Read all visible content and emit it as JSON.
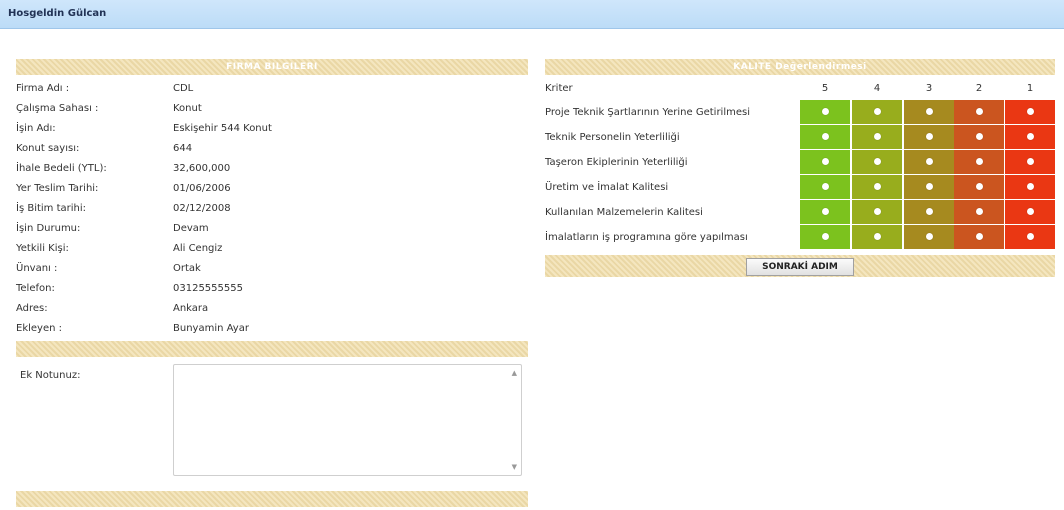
{
  "header": {
    "welcome": "Hosgeldin Gülcan"
  },
  "left_panel": {
    "title": "FIRMA BILGILERI",
    "rows": [
      {
        "label": "Firma Adı :",
        "value": "CDL"
      },
      {
        "label": "Çalışma Sahası :",
        "value": "Konut"
      },
      {
        "label": "İşin Adı:",
        "value": "Eskişehir 544 Konut"
      },
      {
        "label": "Konut sayısı:",
        "value": "644"
      },
      {
        "label": "İhale Bedeli (YTL):",
        "value": "32,600,000"
      },
      {
        "label": "Yer Teslim Tarihi:",
        "value": "01/06/2006"
      },
      {
        "label": "İş Bitim tarihi:",
        "value": "02/12/2008"
      },
      {
        "label": "İşin Durumu:",
        "value": "Devam"
      },
      {
        "label": "Yetkili Kişi:",
        "value": "Ali Cengiz"
      },
      {
        "label": "Ünvanı :",
        "value": "Ortak"
      },
      {
        "label": "Telefon:",
        "value": "03125555555"
      },
      {
        "label": "Adres:",
        "value": "Ankara"
      },
      {
        "label": "Ekleyen :",
        "value": "Bunyamin Ayar"
      }
    ],
    "note_label": "Ek Notunuz:",
    "note_value": ""
  },
  "right_panel": {
    "title": "KALITE Değerlendirmesi",
    "criteria_label": "Kriter",
    "scores": [
      "5",
      "4",
      "3",
      "2",
      "1"
    ],
    "score_colors": [
      "#7cc21e",
      "#98ad1d",
      "#a68a1f",
      "#cb551f",
      "#ea3713"
    ],
    "criteria": [
      "Proje Teknik Şartlarının Yerine Getirilmesi",
      "Teknik Personelin Yeterliliği",
      "Taşeron Ekiplerinin Yeterliliği",
      "Üretim ve İmalat Kalitesi",
      "Kullanılan Malzemelerin Kalitesi",
      "İmalatların iş programına göre yapılması"
    ],
    "next_button": "SONRAKİ ADIM"
  }
}
